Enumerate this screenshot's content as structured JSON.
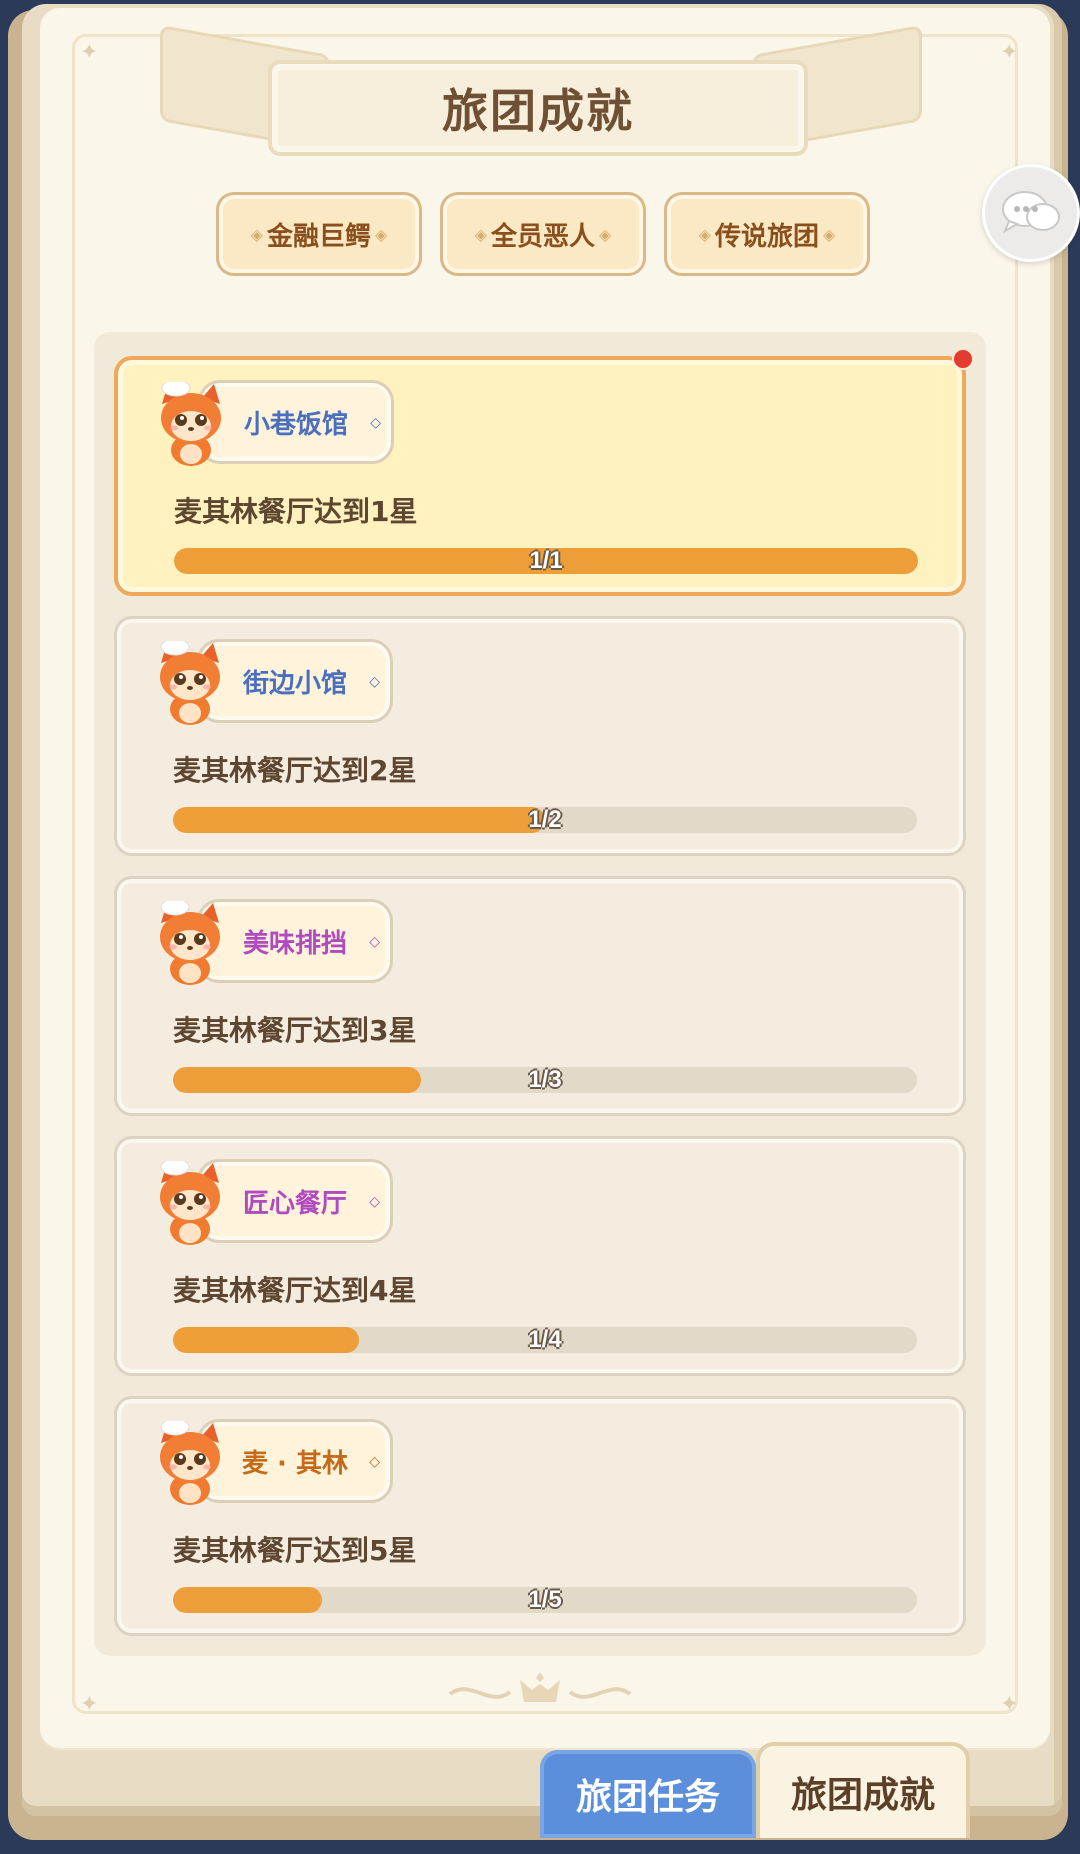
{
  "title": "旅团成就",
  "category_tabs": [
    {
      "label": "金融巨鳄"
    },
    {
      "label": "全员恶人"
    },
    {
      "label": "传说旅团"
    }
  ],
  "achievements": [
    {
      "badge": "小巷饭馆",
      "badge_color": "#4a6fbf",
      "task": "麦其林餐厅达到1星",
      "progress_text": "1/1",
      "progress": 1.0,
      "active": true,
      "red_dot": true
    },
    {
      "badge": "街边小馆",
      "badge_color": "#4a6fbf",
      "task": "麦其林餐厅达到2星",
      "progress_text": "1/2",
      "progress": 0.5,
      "active": false,
      "red_dot": false
    },
    {
      "badge": "美味排挡",
      "badge_color": "#b04ac0",
      "task": "麦其林餐厅达到3星",
      "progress_text": "1/3",
      "progress": 0.333,
      "active": false,
      "red_dot": false
    },
    {
      "badge": "匠心餐厅",
      "badge_color": "#b04ac0",
      "task": "麦其林餐厅达到4星",
      "progress_text": "1/4",
      "progress": 0.25,
      "active": false,
      "red_dot": false
    },
    {
      "badge": "麦 · 其林",
      "badge_color": "#c46a18",
      "task": "麦其林餐厅达到5星",
      "progress_text": "1/5",
      "progress": 0.2,
      "active": false,
      "red_dot": false
    }
  ],
  "bottom_tabs": {
    "tasks_label": "旅团任务",
    "achievements_label": "旅团成就",
    "selected": "旅团成就"
  },
  "icons": {
    "chat": "chat-bubbles-icon",
    "mascot": "fox-chef-mascot-icon"
  },
  "colors": {
    "accent": "#ee9e38",
    "active_card": "#fff2bf",
    "tab_blue": "#5b8fdc"
  }
}
